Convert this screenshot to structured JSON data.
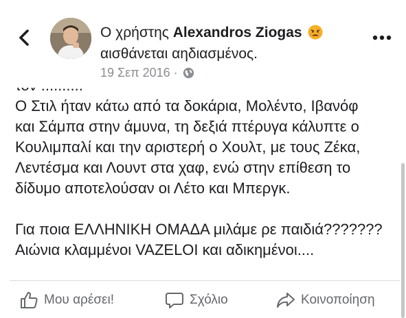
{
  "header": {
    "status_prefix": "Ο χρήστης ",
    "author_name": "Alexandros Ziogas",
    "status_suffix": "αισθάνεται αηδιασμένος.",
    "feeling_emoji": "disgusted-face-icon",
    "date": "19 Σεπ 2016",
    "separator": "·",
    "privacy_icon": "globe-icon"
  },
  "post": {
    "lines_top": [
      "τον ..........",
      "Ο Στιλ ήταν κάτω από τα δοκάρια, Μολέντο, Ιβανόφ",
      "και Σάμπα στην άμυνα, τη δεξιά πτέρυγα κάλυπτε ο",
      "Κουλιμπαλί και την αριστερή ο Χουλτ, με τους Ζέκα,",
      "Λεντέσμα και Λουντ στα χαφ, ενώ στην επίθεση το",
      "δίδυμο αποτελούσαν οι Λέτο και Μπεργκ."
    ],
    "lines_bottom": [
      "Για ποια ΕΛΛΗΝΙΚΗ ΟΜΑΔΑ μιλάμε ρε παιδιά???????",
      "Αιώνια κλαμμένοι VAZELOI και αδικημένοι...."
    ]
  },
  "actions": {
    "like_label": "Μου αρέσει!",
    "comment_label": "Σχόλιο",
    "share_label": "Κοινοποίηση"
  },
  "colors": {
    "text": "#1c1e21",
    "secondary": "#65676b",
    "meta": "#8a8d91",
    "emoji": "#f7b125"
  }
}
